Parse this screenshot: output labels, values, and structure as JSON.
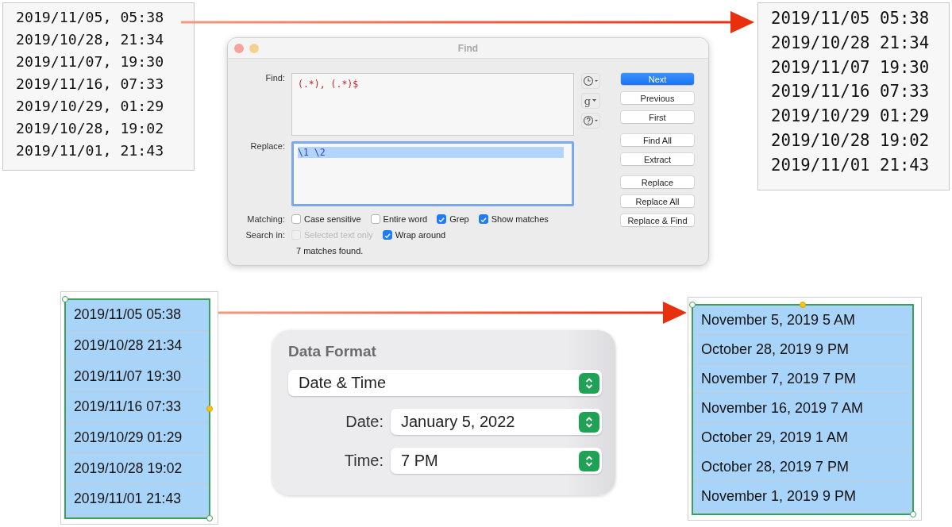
{
  "source_text": {
    "lines": [
      "2019/11/05, 05:38",
      "2019/10/28, 21:34",
      "2019/11/07, 19:30",
      "2019/11/16, 07:33",
      "2019/10/29, 01:29",
      "2019/10/28, 19:02",
      "2019/11/01, 21:43"
    ]
  },
  "find_dialog": {
    "title": "Find",
    "find": {
      "label": "Find:",
      "value": "(.*), (.*)$"
    },
    "replace": {
      "label": "Replace:",
      "value": "\\1 \\2",
      "focused": true
    },
    "menus": [
      {
        "kind": "clock"
      },
      {
        "kind": "glyph",
        "glyph": "g"
      },
      {
        "kind": "help"
      }
    ],
    "button_groups": [
      [
        {
          "label": "Next",
          "primary": true
        },
        {
          "label": "Previous",
          "primary": false
        },
        {
          "label": "First",
          "primary": false
        }
      ],
      [
        {
          "label": "Find All",
          "primary": false
        },
        {
          "label": "Extract",
          "primary": false
        }
      ],
      [
        {
          "label": "Replace",
          "primary": false
        },
        {
          "label": "Replace All",
          "primary": false
        },
        {
          "label": "Replace & Find",
          "primary": false
        }
      ]
    ],
    "option_rows": [
      {
        "label": "Matching:",
        "options": [
          {
            "label": "Case sensitive",
            "checked": false,
            "disabled": false
          },
          {
            "label": "Entire word",
            "checked": false,
            "disabled": false
          },
          {
            "label": "Grep",
            "checked": true,
            "disabled": false
          },
          {
            "label": "Show matches",
            "checked": true,
            "disabled": false
          }
        ]
      },
      {
        "label": "Search in:",
        "options": [
          {
            "label": "Selected text only",
            "checked": false,
            "disabled": true
          },
          {
            "label": "Wrap around",
            "checked": true,
            "disabled": false
          }
        ]
      }
    ],
    "status": "7 matches found."
  },
  "result_text": {
    "lines": [
      "2019/11/05 05:38",
      "2019/10/28 21:34",
      "2019/11/07 19:30",
      "2019/11/16 07:33",
      "2019/10/29 01:29",
      "2019/10/28 19:02",
      "2019/11/01 21:43"
    ]
  },
  "source_table": {
    "selected": true,
    "rows": [
      "2019/11/05 05:38",
      "2019/10/28 21:34",
      "2019/11/07 19:30",
      "2019/11/16 07:33",
      "2019/10/29 01:29",
      "2019/10/28 19:02",
      "2019/11/01 21:43"
    ]
  },
  "data_format": {
    "title": "Data Format",
    "format": {
      "value": "Date & Time"
    },
    "date": {
      "label": "Date:",
      "value": "January 5, 2022"
    },
    "time": {
      "label": "Time:",
      "value": "7 PM"
    }
  },
  "result_table": {
    "selected": true,
    "rows": [
      "November 5, 2019 5 AM",
      "October 28, 2019 9 PM",
      "November 7, 2019 7 PM",
      "November 16, 2019 7 AM",
      "October 29, 2019 1 AM",
      "October 28, 2019 7 PM",
      "November 1, 2019 9 PM"
    ]
  }
}
